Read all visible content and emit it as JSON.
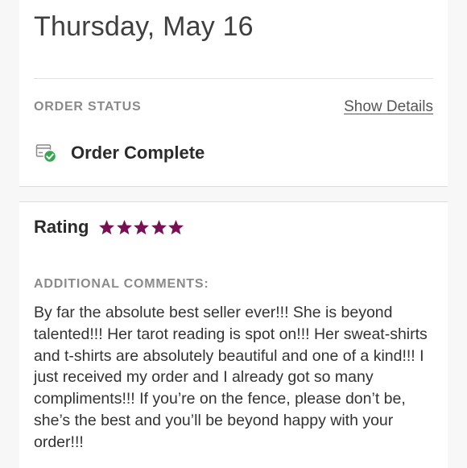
{
  "order": {
    "date": "Thursday, May 16",
    "status_label": "ORDER STATUS",
    "show_details": "Show Details",
    "status": "Order Complete"
  },
  "review": {
    "rating_label": "Rating",
    "rating": 5,
    "rating_max": 5,
    "star_color": "#7a1054",
    "comments_label": "ADDITIONAL COMMENTS:",
    "comment": "By far the absolute best seller ever!!! She is beyond talented!!! Her tarot reading is spot on!!! Her sweat-shirts and t-shirts are absolutely beautiful and one of a kind!!! I just received my order and I already got so many compliments!!! If you’re on the fence, please don’t be, she’s the best and you’ll be beyond happy with your order!!!"
  },
  "icons": {
    "status": "package-check-icon",
    "rating": "star-icon"
  },
  "colors": {
    "status_check": "#3aa655"
  }
}
